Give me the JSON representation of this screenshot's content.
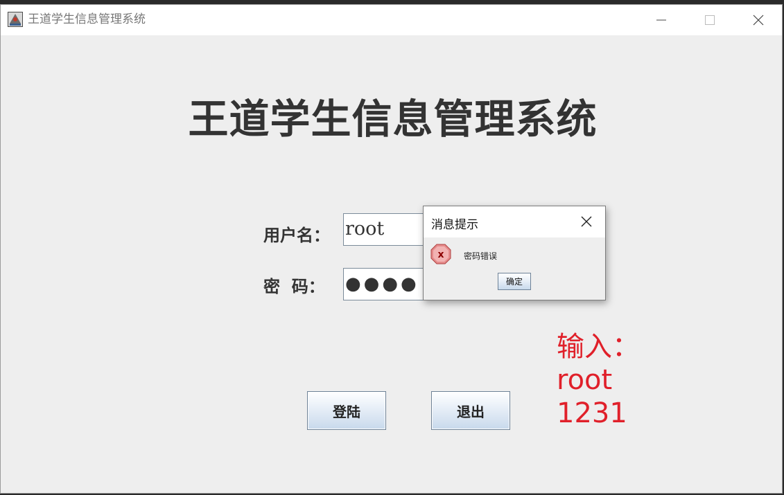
{
  "window": {
    "title": "王道学生信息管理系统",
    "minimize_icon": "minimize-icon",
    "maximize_icon": "maximize-icon",
    "close_icon": "close-icon"
  },
  "main": {
    "heading": "王道学生信息管理系统",
    "username_label": "用户名：",
    "username_value": "root",
    "password_label": "密  码：",
    "password_value": "●●●●",
    "login_button": "登陆",
    "exit_button": "退出"
  },
  "annotation": {
    "line1": "输入：",
    "line2": "root",
    "line3": "1231",
    "color": "#e0202a"
  },
  "dialog": {
    "title": "消息提示",
    "message": "密码错误",
    "ok_button": "确定",
    "icon": "error-icon"
  }
}
